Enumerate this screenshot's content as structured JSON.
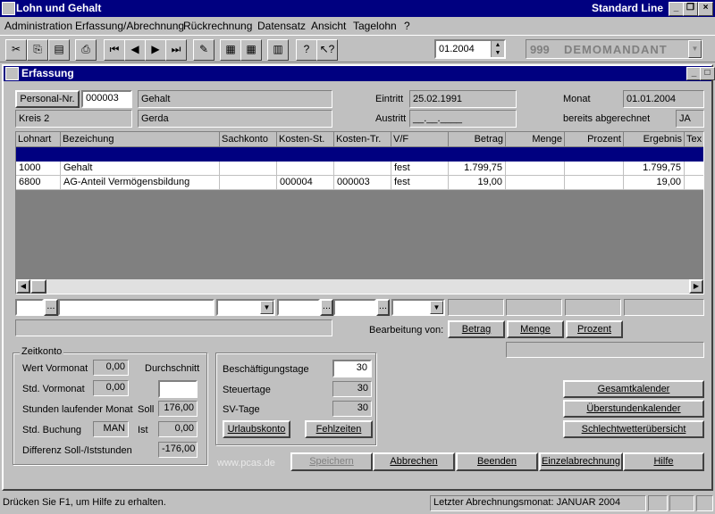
{
  "app": {
    "title": "Lohn und Gehalt",
    "edition": "Standard Line"
  },
  "menu": [
    "Administration",
    "Erfassung/Abrechnung",
    "Rückrechnung",
    "Datensatz",
    "Ansicht",
    "Tagelohn",
    "?"
  ],
  "toolbar": {
    "period": "01.2004",
    "client_no": "999",
    "client_name": "DEMOMANDANT"
  },
  "child": {
    "title": "Erfassung"
  },
  "header": {
    "personal_button": "Personal-Nr.",
    "personal_no": "000003",
    "pay_type": "Gehalt",
    "district": "Kreis 2",
    "first_name": "Gerda",
    "entry_label": "Eintritt",
    "entry_date": "25.02.1991",
    "exit_label": "Austritt",
    "exit_date": "__.__.____",
    "month_label": "Monat",
    "month_value": "01.01.2004",
    "settled_label": "bereits abgerechnet",
    "settled_value": "JA"
  },
  "grid": {
    "columns": [
      "Lohnart",
      "Bezeichung",
      "Sachkonto",
      "Kosten-St.",
      "Kosten-Tr.",
      "V/F",
      "Betrag",
      "Menge",
      "Prozent",
      "Ergebnis",
      "Tex"
    ],
    "rows": [
      [
        "",
        "",
        "",
        "",
        "",
        "",
        "",
        "",
        "",
        "",
        ""
      ],
      [
        "1000",
        "Gehalt",
        "",
        "",
        "",
        "fest",
        "1.799,75",
        "",
        "",
        "1.799,75",
        ""
      ],
      [
        "6800",
        "AG-Anteil Vermögensbildung",
        "",
        "000004",
        "000003",
        "fest",
        "19,00",
        "",
        "",
        "19,00",
        ""
      ]
    ]
  },
  "edit": {
    "mode_label": "Bearbeitung von:",
    "betrag": "Betrag",
    "menge": "Menge",
    "prozent": "Prozent"
  },
  "zeitkonto": {
    "title": "Zeitkonto",
    "wert_vormonat_label": "Wert Vormonat",
    "wert_vormonat": "0,00",
    "durchschnitt_label": "Durchschnitt",
    "durchschnitt": "",
    "std_vormonat_label": "Std. Vormonat",
    "std_vormonat": "0,00",
    "stunden_lfd_label": "Stunden laufender Monat",
    "soll_label": "Soll",
    "soll": "176,00",
    "std_buchung_label": "Std. Buchung",
    "std_buchung": "MAN",
    "ist_label": "Ist",
    "ist": "0,00",
    "differenz_label": "Differenz Soll-/Iststunden",
    "differenz": "-176,00"
  },
  "days": {
    "beschaeftigung_label": "Beschäftigungstage",
    "beschaeftigung": "30",
    "steuer_label": "Steuertage",
    "steuer": "30",
    "sv_label": "SV-Tage",
    "sv": "30",
    "urlaub_button": "Urlaubskonto",
    "fehl_button": "Fehlzeiten"
  },
  "side_buttons": [
    "Gesamtkalender",
    "Überstundenkalender",
    "Schlechtwetterübersicht"
  ],
  "watermark": "www.pcas.de",
  "bottom_buttons": [
    "Speichern",
    "Abbrechen",
    "Beenden",
    "Einzelabrechnung",
    "Hilfe"
  ],
  "status": {
    "help": "Drücken Sie F1, um Hilfe zu erhalten.",
    "last_period": "Letzter Abrechnungsmonat: JANUAR 2004"
  }
}
